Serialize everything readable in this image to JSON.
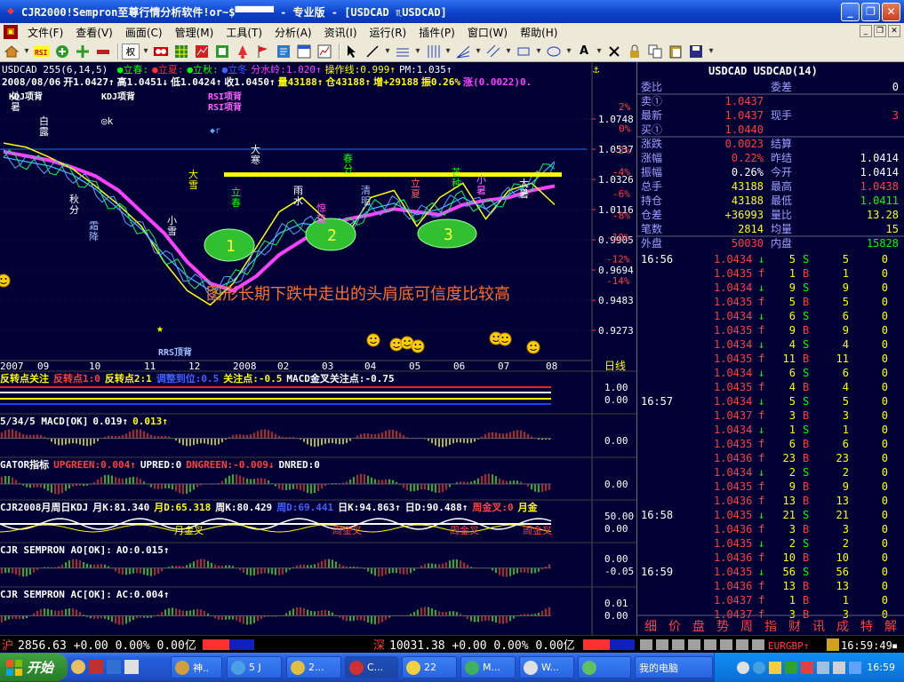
{
  "window": {
    "title": "CJR2000!Sempron至尊行情分析软件!or~$▀▀▀▀▀▀  - 专业版 - [USDCAD ♏USDCAD]",
    "minimize": "_",
    "restore": "❐",
    "close": "✕"
  },
  "menu": [
    "文件(F)",
    "查看(V)",
    "画面(C)",
    "管理(M)",
    "工具(T)",
    "分析(A)",
    "资讯(I)",
    "运行(R)",
    "插件(P)",
    "窗口(W)",
    "帮助(H)"
  ],
  "toolbar": {
    "rights_label": "权"
  },
  "chart_data": {
    "type": "line",
    "title": "USDCAD 255(6,14,5)",
    "header_items": [
      {
        "text": "●立春:",
        "color": "#00ff00"
      },
      {
        "text": "●立夏:",
        "color": "#ff3030"
      },
      {
        "text": "●立秋:",
        "color": "#00ff00"
      },
      {
        "text": "●立冬",
        "color": "#4060ff"
      },
      {
        "text": "分水岭:1.020↑",
        "color": "#ff40ff"
      },
      {
        "text": "操作线:0.999↑",
        "color": "#ffff00"
      },
      {
        "text": "PM:1.035↑",
        "color": "#ffffff"
      }
    ],
    "ohlc_line": [
      {
        "text": "2008/08/06",
        "color": "#ffffff"
      },
      {
        "text": "开1.0427↑",
        "color": "#ffffff"
      },
      {
        "text": "高1.0451↓",
        "color": "#ffffff"
      },
      {
        "text": "低1.0424↑",
        "color": "#ffffff"
      },
      {
        "text": "收1.0450↑",
        "color": "#ffffff"
      },
      {
        "text": "量43188↑",
        "color": "#ffff00"
      },
      {
        "text": "仓43188↑",
        "color": "#ffff00"
      },
      {
        "text": "增+29188",
        "color": "#ffff00"
      },
      {
        "text": "振0.26%",
        "color": "#ffff00"
      },
      {
        "text": "涨(0.0022)0.",
        "color": "#ff40ff"
      }
    ],
    "y_ticks": [
      "1.0748",
      "1.0537",
      "1.0326",
      "1.0116",
      "0.9905",
      "0.9694",
      "0.9483",
      "0.9273"
    ],
    "pct_ticks": [
      "2%",
      "0%",
      "-2%",
      "-4%",
      "-6%",
      "-8%",
      "-10%",
      "-12%",
      "-14%"
    ],
    "x_ticks": [
      "2007",
      "09",
      "10",
      "11",
      "12",
      "2008",
      "02",
      "03",
      "04",
      "05",
      "06",
      "07",
      "08"
    ],
    "period": "日线",
    "annotation": "图形长期下跌中走出的头肩底可信度比较高",
    "shoulder_labels": [
      "1",
      "2",
      "3"
    ],
    "indicator_labels": [
      "KDJ项背",
      "KDJ项背",
      "RSI项背",
      "RSI项背",
      "RRS顶背"
    ],
    "solar_terms": [
      "处暑",
      "白露",
      "秋分",
      "霜降",
      "大雪",
      "小雪",
      "大寒",
      "立春",
      "雨水",
      "惊蛰",
      "春分",
      "清明",
      "立夏",
      "芒种",
      "小暑",
      "大暑"
    ],
    "series": [
      {
        "name": "分水岭",
        "values": [
          1.052,
          1.049,
          1.046,
          1.041,
          1.035,
          1.025,
          1.01,
          0.995,
          0.975,
          0.96,
          0.955,
          0.965,
          0.98,
          0.99,
          1.0,
          1.005,
          1.008,
          1.012,
          1.01,
          1.008,
          1.015,
          1.018,
          1.02,
          1.025,
          1.028
        ]
      },
      {
        "name": "操作线",
        "values": [
          1.058,
          1.055,
          1.048,
          1.04,
          1.028,
          1.015,
          1.0,
          0.975,
          0.955,
          0.945,
          0.96,
          0.985,
          1.01,
          1.02,
          1.005,
          0.995,
          1.02,
          1.025,
          1.0,
          1.02,
          1.03,
          1.005,
          1.025,
          1.03,
          1.015
        ]
      },
      {
        "name": "PM",
        "values": [
          1.048,
          1.045,
          1.042,
          1.036,
          1.026,
          1.012,
          0.998,
          0.98,
          0.965,
          0.955,
          0.962,
          0.978,
          0.995,
          1.002,
          1.0,
          1.0,
          1.012,
          1.016,
          1.008,
          1.012,
          1.02,
          1.012,
          1.022,
          1.03,
          1.045
        ]
      }
    ],
    "neckline": 1.036
  },
  "sub_panels": {
    "p1": {
      "items": [
        {
          "text": "反转点关注",
          "color": "#ffff00"
        },
        {
          "text": "反转点1:0",
          "color": "#ff4040"
        },
        {
          "text": "反转点2:1",
          "color": "#ffff00"
        },
        {
          "text": "调整到位:0.5",
          "color": "#4060ff"
        },
        {
          "text": "关注点:-0.5",
          "color": "#ffff00"
        },
        {
          "text": "MACD金叉关注点:-0.75",
          "color": "#ffffff"
        }
      ],
      "ticks": [
        "1.00",
        "0.00"
      ]
    },
    "p2": {
      "items": [
        {
          "text": "5/34/5 MACD[OK]",
          "color": "#ffffff"
        },
        {
          "text": "0.019↑",
          "color": "#ffffff"
        },
        {
          "text": "0.013↑",
          "color": "#ffff00"
        }
      ],
      "ticks": [
        "0.00"
      ]
    },
    "p3": {
      "items": [
        {
          "text": "GATOR指标",
          "color": "#ffffff"
        },
        {
          "text": "UPGREEN:0.004↑",
          "color": "#ff4040"
        },
        {
          "text": "UPRED:0",
          "color": "#ffffff"
        },
        {
          "text": "DNGREEN:-0.009↓",
          "color": "#ff4040"
        },
        {
          "text": "DNRED:0",
          "color": "#ffffff"
        }
      ],
      "ticks": [
        "0.00"
      ]
    },
    "p4": {
      "items": [
        {
          "text": "CJR2008月周日KDJ",
          "color": "#ffffff"
        },
        {
          "text": "月K:81.340",
          "color": "#ffffff"
        },
        {
          "text": "月D:65.318",
          "color": "#ffff00"
        },
        {
          "text": "周K:80.429",
          "color": "#ffffff"
        },
        {
          "text": "周D:69.441",
          "color": "#4060ff"
        },
        {
          "text": "日K:94.863↑",
          "color": "#ffffff"
        },
        {
          "text": "日D:90.488↑",
          "color": "#ffffff"
        },
        {
          "text": "周金叉:0",
          "color": "#ff4040"
        },
        {
          "text": "月金",
          "color": "#ffff00"
        }
      ],
      "ticks": [
        "50.00",
        "0.00"
      ],
      "marks": [
        "月金叉",
        "周金叉",
        "周金叉",
        "周金叉"
      ]
    },
    "p5": {
      "items": [
        {
          "text": "CJR SEMPRON AO[OK]:",
          "color": "#ffffff"
        },
        {
          "text": "AO:0.015↑",
          "color": "#ffffff"
        }
      ],
      "ticks": [
        "0.00",
        "-0.05"
      ]
    },
    "p6": {
      "items": [
        {
          "text": "CJR SEMPRON  AC[OK]:",
          "color": "#ffffff"
        },
        {
          "text": "AC:0.004↑",
          "color": "#ffffff"
        }
      ],
      "ticks": [
        "0.01",
        "0.00"
      ]
    }
  },
  "quote": {
    "header": "USDCAD  USDCAD(14)",
    "rows": [
      [
        {
          "t": "委比",
          "c": "#a0a0ff"
        },
        {
          "t": "",
          "c": "#ff4040"
        },
        {
          "t": "委差",
          "c": "#a0a0ff"
        },
        {
          "t": "0",
          "c": "#ffffff"
        }
      ],
      [
        {
          "t": "卖①",
          "c": "#a0a0ff"
        },
        {
          "t": "1.0437",
          "c": "#ff4040"
        },
        {
          "t": "",
          "c": "#a0a0ff"
        },
        {
          "t": "",
          "c": "#ffffff"
        }
      ],
      [
        {
          "t": "最新",
          "c": "#a0a0ff"
        },
        {
          "t": "1.0437",
          "c": "#ff4040"
        },
        {
          "t": "现手",
          "c": "#a0a0ff"
        },
        {
          "t": "3",
          "c": "#ff4040"
        }
      ],
      [
        {
          "t": "买①",
          "c": "#a0a0ff"
        },
        {
          "t": "1.0440",
          "c": "#ff4040"
        },
        {
          "t": "",
          "c": "#a0a0ff"
        },
        {
          "t": "",
          "c": "#ffffff"
        }
      ],
      [
        {
          "t": "涨跌",
          "c": "#a0a0ff"
        },
        {
          "t": "0.0023",
          "c": "#ff4040"
        },
        {
          "t": "结算",
          "c": "#a0a0ff"
        },
        {
          "t": "",
          "c": "#ffffff"
        }
      ],
      [
        {
          "t": "涨幅",
          "c": "#a0a0ff"
        },
        {
          "t": "0.22%",
          "c": "#ff4040"
        },
        {
          "t": "昨结",
          "c": "#a0a0ff"
        },
        {
          "t": "1.0414",
          "c": "#ffffff"
        }
      ],
      [
        {
          "t": "振幅",
          "c": "#a0a0ff"
        },
        {
          "t": "0.26%",
          "c": "#ffffff"
        },
        {
          "t": "今开",
          "c": "#a0a0ff"
        },
        {
          "t": "1.0414",
          "c": "#ffffff"
        }
      ],
      [
        {
          "t": "总手",
          "c": "#a0a0ff"
        },
        {
          "t": "43188",
          "c": "#ffff00"
        },
        {
          "t": "最高",
          "c": "#a0a0ff"
        },
        {
          "t": "1.0438",
          "c": "#ff4040"
        }
      ],
      [
        {
          "t": "持仓",
          "c": "#a0a0ff"
        },
        {
          "t": "43188",
          "c": "#ffff00"
        },
        {
          "t": "最低",
          "c": "#a0a0ff"
        },
        {
          "t": "1.0411",
          "c": "#00ff00"
        }
      ],
      [
        {
          "t": "仓差",
          "c": "#a0a0ff"
        },
        {
          "t": "+36993",
          "c": "#ffff00"
        },
        {
          "t": "量比",
          "c": "#a0a0ff"
        },
        {
          "t": "13.28",
          "c": "#ffff00"
        }
      ],
      [
        {
          "t": "笔数",
          "c": "#a0a0ff"
        },
        {
          "t": "2814",
          "c": "#ffff00"
        },
        {
          "t": "均量",
          "c": "#a0a0ff"
        },
        {
          "t": "15",
          "c": "#ffff00"
        }
      ],
      [
        {
          "t": "外盘",
          "c": "#a0a0ff"
        },
        {
          "t": "50030",
          "c": "#ff4040"
        },
        {
          "t": "内盘",
          "c": "#a0a0ff"
        },
        {
          "t": "15828",
          "c": "#00ff00"
        }
      ]
    ],
    "ticks": [
      [
        "16:56",
        "1.0434",
        "↓",
        "5",
        "S",
        "5",
        "0"
      ],
      [
        "",
        "1.0435",
        "f",
        "1",
        "B",
        "1",
        "0"
      ],
      [
        "",
        "1.0434",
        "↓",
        "9",
        "S",
        "9",
        "0"
      ],
      [
        "",
        "1.0435",
        "f",
        "5",
        "B",
        "5",
        "0"
      ],
      [
        "",
        "1.0434",
        "↓",
        "6",
        "S",
        "6",
        "0"
      ],
      [
        "",
        "1.0435",
        "f",
        "9",
        "B",
        "9",
        "0"
      ],
      [
        "",
        "1.0434",
        "↓",
        "4",
        "S",
        "4",
        "0"
      ],
      [
        "",
        "1.0435",
        "f",
        "11",
        "B",
        "11",
        "0"
      ],
      [
        "",
        "1.0434",
        "↓",
        "6",
        "S",
        "6",
        "0"
      ],
      [
        "",
        "1.0435",
        "f",
        "4",
        "B",
        "4",
        "0"
      ],
      [
        "16:57",
        "1.0434",
        "↓",
        "5",
        "S",
        "5",
        "0"
      ],
      [
        "",
        "1.0437",
        "f",
        "3",
        "B",
        "3",
        "0"
      ],
      [
        "",
        "1.0434",
        "↓",
        "1",
        "S",
        "1",
        "0"
      ],
      [
        "",
        "1.0435",
        "f",
        "6",
        "B",
        "6",
        "0"
      ],
      [
        "",
        "1.0436",
        "f",
        "23",
        "B",
        "23",
        "0"
      ],
      [
        "",
        "1.0434",
        "↓",
        "2",
        "S",
        "2",
        "0"
      ],
      [
        "",
        "1.0435",
        "f",
        "9",
        "B",
        "9",
        "0"
      ],
      [
        "",
        "1.0436",
        "f",
        "13",
        "B",
        "13",
        "0"
      ],
      [
        "16:58",
        "1.0435",
        "↓",
        "21",
        "S",
        "21",
        "0"
      ],
      [
        "",
        "1.0436",
        "f",
        "3",
        "B",
        "3",
        "0"
      ],
      [
        "",
        "1.0435",
        "↓",
        "2",
        "S",
        "2",
        "0"
      ],
      [
        "",
        "1.0436",
        "f",
        "10",
        "B",
        "10",
        "0"
      ],
      [
        "16:59",
        "1.0435",
        "↓",
        "56",
        "S",
        "56",
        "0"
      ],
      [
        "",
        "1.0436",
        "f",
        "13",
        "B",
        "13",
        "0"
      ],
      [
        "",
        "1.0437",
        "f",
        "1",
        "B",
        "1",
        "0"
      ],
      [
        "",
        "1.0437",
        "f",
        "3",
        "B",
        "3",
        "0"
      ]
    ],
    "tabs": [
      "细",
      "价",
      "盘",
      "势",
      "周",
      "指",
      "财",
      "讯",
      "成",
      "特",
      "解"
    ]
  },
  "status": {
    "sh_label": "沪",
    "sh_values": "2856.63 +0.00 0.00% 0.00亿",
    "sz_label": "深",
    "sz_values": "10031.38 +0.00 0.00% 0.00亿",
    "pair": "EURGBP↑",
    "clock": "16:59:49"
  },
  "taskbar": {
    "start": "开始",
    "tasks": [
      "神..",
      "5 J",
      "2...",
      "C...",
      "22",
      "M...",
      "W...",
      "",
      "我的电脑"
    ],
    "tray_time": "16:59"
  }
}
